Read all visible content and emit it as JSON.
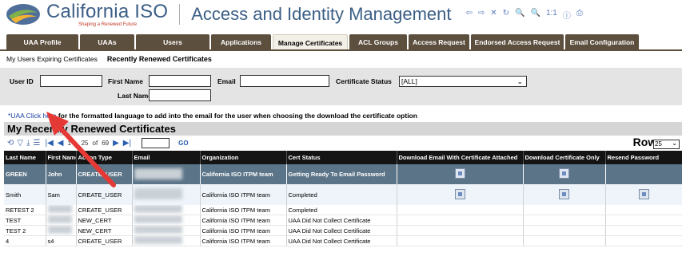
{
  "header": {
    "logo_name": "California ISO",
    "logo_tagline": "Shaping a Renewed Future",
    "app_title": "Access and Identity Management",
    "toolbar_icons": [
      "⇦",
      "⇨",
      "✕",
      "↻",
      "🔍",
      "🔍",
      "1:1",
      "ⓘ",
      "⎙"
    ]
  },
  "tabs": [
    {
      "label": "UAA Profile"
    },
    {
      "label": "UAAs"
    },
    {
      "label": "Users"
    },
    {
      "label": "Applications"
    },
    {
      "label": "Manage Certificates"
    },
    {
      "label": "ACL Groups"
    },
    {
      "label": "Access Request"
    },
    {
      "label": "Endorsed Access Request"
    },
    {
      "label": "Email Configuration"
    }
  ],
  "subtabs": {
    "expiring": "My Users Expiring Certificates",
    "renewed": "Recently Renewed Certificates"
  },
  "filters": {
    "user_id_label": "User ID",
    "first_name_label": "First Name",
    "last_name_label": "Last Name",
    "email_label": "Email",
    "cert_status_label": "Certificate Status",
    "cert_status_value": "[ALL]"
  },
  "notice": {
    "link": "*UAA Click here",
    "text": " for the formatted language to add into the email for the user when choosing the download the certificate option"
  },
  "grid": {
    "title": "My Recently Renewed Certificates",
    "pager": {
      "first": "1",
      "separator": "-",
      "last": "25",
      "of": "of",
      "total": "69",
      "go": "GO"
    },
    "rows_label": "Rows",
    "rows_value": "25",
    "columns": [
      "Last Name",
      "First Name",
      "Action Type",
      "Email",
      "Organization",
      "Cert Status",
      "Download Email With Certificate Attached",
      "Download Certificate Only",
      "Resend Password"
    ],
    "rows": [
      {
        "last": "GREEN",
        "first": "John",
        "action": "CREATE_USER",
        "org": "California ISO ITPM team",
        "status": "Getting Ready To Email Password"
      },
      {
        "last": "Smith",
        "first": "Sam",
        "action": "CREATE_USER",
        "org": "California ISO ITPM team",
        "status": "Completed"
      },
      {
        "last": "RETEST 2",
        "first": "",
        "action": "CREATE_USER",
        "org": "California ISO ITPM team",
        "status": "Completed"
      },
      {
        "last": "TEST",
        "first": "",
        "action": "NEW_CERT",
        "org": "California ISO ITPM team",
        "status": "UAA Did Not Collect Certificate"
      },
      {
        "last": "TEST 2",
        "first": "",
        "action": "NEW_CERT",
        "org": "California ISO ITPM team",
        "status": "UAA Did Not Collect Certificate"
      },
      {
        "last": "4",
        "first": "s4",
        "action": "CREATE_USER",
        "org": "California ISO ITPM team",
        "status": "UAA Did Not Collect Certificate"
      }
    ]
  },
  "colors": {
    "tab_bg": "#5d4f3e",
    "header_text": "#3b5f86",
    "highlight_row": "#5b7487",
    "annotation_arrow": "#e53935"
  }
}
